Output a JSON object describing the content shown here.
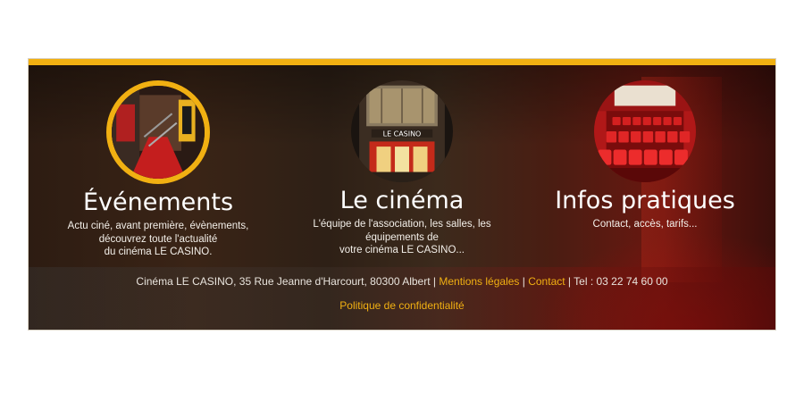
{
  "columns": [
    {
      "title": "Événements",
      "desc_lines": [
        "Actu ciné, avant première, évènements,",
        "découvrez toute l'actualité",
        "du cinéma LE CASINO."
      ],
      "thumb_icon": "staircase-photo-icon"
    },
    {
      "title": "Le cinéma",
      "desc_lines": [
        "L'équipe de l'association, les salles, les",
        "équipements de",
        "votre cinéma LE CASINO..."
      ],
      "thumb_icon": "cinema-facade-photo-icon",
      "sign_text": "LE CASINO"
    },
    {
      "title": "Infos pratiques",
      "desc_lines": [
        "Contact, accès, tarifs..."
      ],
      "thumb_icon": "theater-seats-photo-icon"
    }
  ],
  "footer": {
    "address": "Cinéma LE CASINO, 35 Rue Jeanne d'Harcourt, 80300 Albert",
    "sep1": " | ",
    "legal_link": "Mentions légales",
    "sep2": " | ",
    "contact_link": "Contact",
    "phone_text": " | Tel : 03 22 74 60 00",
    "privacy_link": "Politique de confidentialité"
  },
  "colors": {
    "accent": "#f1b012",
    "text": "#ffffff",
    "link": "#f1b012"
  }
}
